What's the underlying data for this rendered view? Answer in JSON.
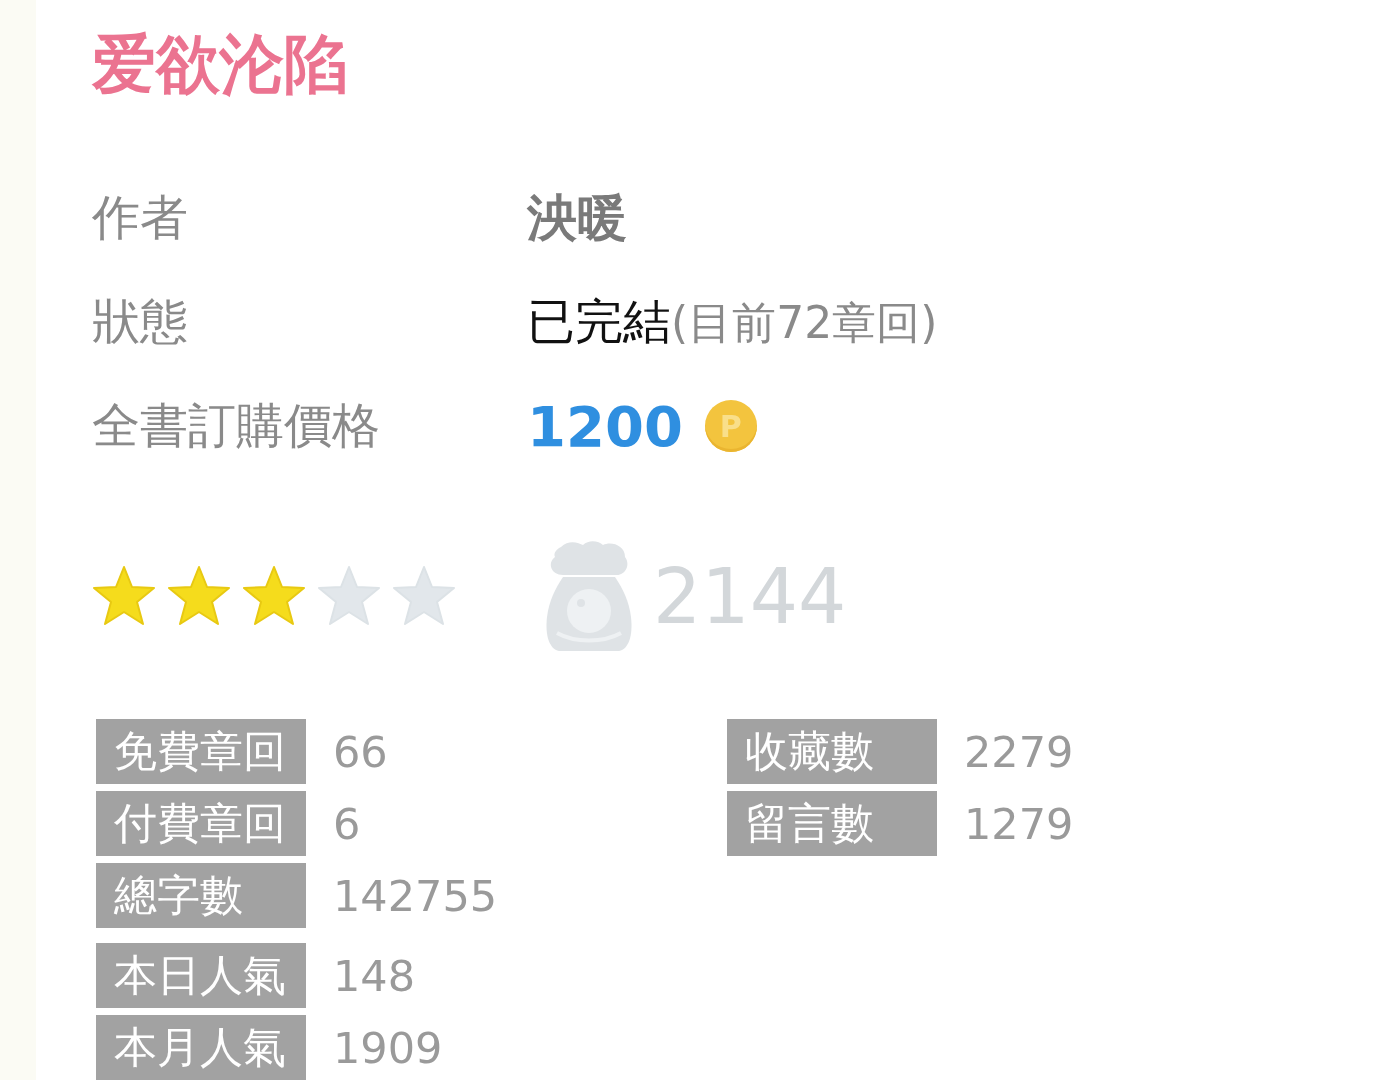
{
  "title": "爱欲沦陷",
  "info": [
    {
      "kind": "author",
      "label": "作者",
      "value": "泱暖"
    },
    {
      "kind": "status",
      "label": "狀態",
      "value": "已完結",
      "note": "(目前72章回)"
    },
    {
      "kind": "price",
      "label": "全書訂購價格",
      "value": "1200",
      "currency": "P"
    }
  ],
  "rating": {
    "stars": 3,
    "count": "2144"
  },
  "stats": {
    "left_groups": [
      [
        {
          "label": "免費章回",
          "value": "66"
        },
        {
          "label": "付費章回",
          "value": "6"
        },
        {
          "label": "總字數",
          "value": "142755"
        }
      ],
      [
        {
          "label": "本日人氣",
          "value": "148"
        },
        {
          "label": "本月人氣",
          "value": "1909"
        }
      ]
    ],
    "right": [
      {
        "label": "收藏數",
        "value": "2279"
      },
      {
        "label": "留言數",
        "value": "1279"
      }
    ]
  }
}
